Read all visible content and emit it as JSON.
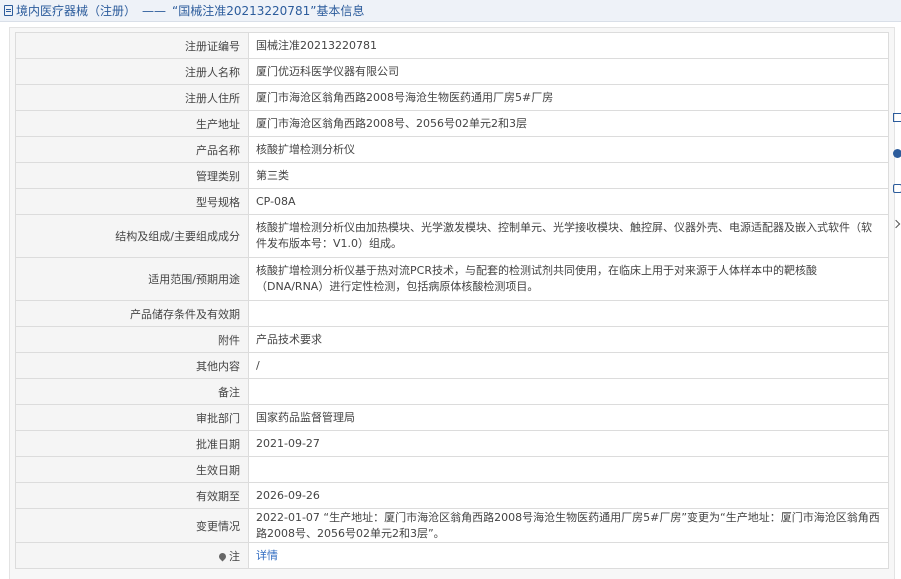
{
  "breadcrumb": {
    "path": "境内医疗器械（注册）",
    "separator": "——",
    "title": "“国械注准20213220781”基本信息"
  },
  "rows": [
    {
      "label": "注册证编号",
      "value": "国械注准20213220781"
    },
    {
      "label": "注册人名称",
      "value": "厦门优迈科医学仪器有限公司"
    },
    {
      "label": "注册人住所",
      "value": "厦门市海沧区翁角西路2008号海沧生物医药通用厂房5#厂房"
    },
    {
      "label": "生产地址",
      "value": "厦门市海沧区翁角西路2008号、2056号02单元2和3层"
    },
    {
      "label": "产品名称",
      "value": "核酸扩增检测分析仪"
    },
    {
      "label": "管理类别",
      "value": "第三类"
    },
    {
      "label": "型号规格",
      "value": "CP-08A"
    },
    {
      "label": "结构及组成/主要组成成分",
      "value": "核酸扩增检测分析仪由加热模块、光学激发模块、控制单元、光学接收模块、触控屏、仪器外壳、电源适配器及嵌入式软件（软件发布版本号：V1.0）组成。"
    },
    {
      "label": "适用范围/预期用途",
      "value": "核酸扩增检测分析仪基于热对流PCR技术，与配套的检测试剂共同使用，在临床上用于对来源于人体样本中的靶核酸（DNA/RNA）进行定性检测，包括病原体核酸检测项目。"
    },
    {
      "label": "产品储存条件及有效期",
      "value": ""
    },
    {
      "label": "附件",
      "value": "产品技术要求"
    },
    {
      "label": "其他内容",
      "value": "/"
    },
    {
      "label": "备注",
      "value": ""
    },
    {
      "label": "审批部门",
      "value": "国家药品监督管理局"
    },
    {
      "label": "批准日期",
      "value": "2021-09-27"
    },
    {
      "label": "生效日期",
      "value": ""
    },
    {
      "label": "有效期至",
      "value": "2026-09-26"
    },
    {
      "label": "变更情况",
      "value": "2022-01-07 “生产地址：厦门市海沧区翁角西路2008号海沧生物医药通用厂房5#厂房”变更为“生产地址：厦门市海沧区翁角西路2008号、2056号02单元2和3层”。"
    }
  ],
  "note": {
    "label": "注",
    "link": "详情"
  },
  "icons": {
    "title": "document-icon",
    "note": "map-pin-icon",
    "side": [
      "edit-icon",
      "help-icon",
      "copy-icon",
      "chevron-right-icon"
    ]
  },
  "colors": {
    "accent": "#2c5c9c",
    "link": "#2f6bc1",
    "label_bg": "#f5f5f5",
    "border": "#dcdcdc"
  }
}
